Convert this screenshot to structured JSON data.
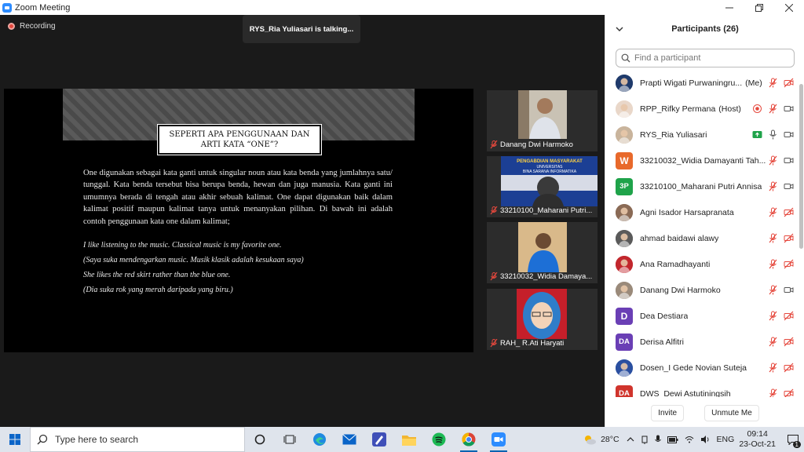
{
  "window": {
    "title": "Zoom Meeting"
  },
  "meeting": {
    "recording_label": "Recording",
    "talking_indicator": "RYS_Ria Yuliasari is talking..."
  },
  "slide": {
    "title_line1": "SEPERTI APA PENGGUNAAN DAN",
    "title_line2": "ARTI KATA “ONE”?",
    "body": "One digunakan sebagai kata ganti untuk singular noun atau kata benda yang jumlahnya satu/ tunggal. Kata benda tersebut bisa berupa benda, hewan dan juga manusia. Kata ganti ini umumnya berada di tengah atau akhir sebuah kalimat. One dapat digunakan baik dalam kalimat positif maupun kalimat tanya untuk menanyakan pilihan. Di bawah ini adalah contoh penggunaan kata one dalam kalimat;",
    "examples": [
      "I like listening to the music. Classical music is my favorite one.",
      "(Saya suka mendengarkan music. Musik klasik adalah kesukaan saya)",
      "She likes the red skirt rather than the blue one.",
      "(Dia suka rok yang merah daripada yang biru.)"
    ]
  },
  "video_tiles": [
    {
      "name": "Danang Dwi Harmoko"
    },
    {
      "name": "33210100_Maharani Putri..."
    },
    {
      "name": "33210032_Widia Damaya..."
    },
    {
      "name": "RAH_ R.Ati Haryati"
    }
  ],
  "tile2_banner": [
    "PENGABDIAN MASYARAKAT",
    "UNIVERSITAS",
    "BINA SARANA INFORMATIKA"
  ],
  "participants_panel": {
    "title": "Participants (26)",
    "search_placeholder": "Find a participant",
    "invite_label": "Invite",
    "unmute_label": "Unmute Me",
    "list": [
      {
        "name": "Prapti Wigati Purwaningru...",
        "tag": "(Me)",
        "avatar_type": "image",
        "color": "#1f3a6b",
        "mic": "muted",
        "video": "off"
      },
      {
        "name": "RPP_Rifky Permana",
        "tag": "(Host)",
        "avatar_type": "image",
        "color": "#e9d7c9",
        "mic": "muted",
        "video": "on",
        "recording": true
      },
      {
        "name": "RYS_Ria Yuliasari",
        "tag": "",
        "avatar_type": "image",
        "color": "#c9b49c",
        "mic": "on",
        "video": "on",
        "share": true
      },
      {
        "name": "33210032_Widia Damayanti Tah...",
        "tag": "",
        "avatar_type": "letter",
        "initials": "W",
        "color": "#e8692b",
        "mic": "muted",
        "video": "on"
      },
      {
        "name": "33210100_Maharani Putri Annisa",
        "tag": "",
        "avatar_type": "letter",
        "initials": "3P",
        "color": "#1fa34a",
        "mic": "muted",
        "video": "on"
      },
      {
        "name": "Agni Isador Harsapranata",
        "tag": "",
        "avatar_type": "image",
        "color": "#8a6a55",
        "mic": "muted",
        "video": "off"
      },
      {
        "name": "ahmad baidawi alawy",
        "tag": "",
        "avatar_type": "image",
        "color": "#5a5a5a",
        "mic": "muted",
        "video": "off"
      },
      {
        "name": "Ana Ramadhayanti",
        "tag": "",
        "avatar_type": "image",
        "color": "#c2272d",
        "mic": "muted",
        "video": "off"
      },
      {
        "name": "Danang Dwi Harmoko",
        "tag": "",
        "avatar_type": "image",
        "color": "#9a8a7a",
        "mic": "muted",
        "video": "on"
      },
      {
        "name": "Dea Destiara",
        "tag": "",
        "avatar_type": "letter",
        "initials": "D",
        "color": "#6a3fb5",
        "mic": "muted",
        "video": "off"
      },
      {
        "name": "Derisa Alfitri",
        "tag": "",
        "avatar_type": "letter",
        "initials": "DA",
        "color": "#6a3fb5",
        "mic": "muted",
        "video": "off"
      },
      {
        "name": "Dosen_I Gede Novian Suteja",
        "tag": "",
        "avatar_type": "image",
        "color": "#2a4fa0",
        "mic": "muted",
        "video": "off"
      },
      {
        "name": "DWS_Dewi Astutiningsih",
        "tag": "",
        "avatar_type": "letter",
        "initials": "DA",
        "color": "#d0342c",
        "mic": "muted",
        "video": "off"
      }
    ]
  },
  "taskbar": {
    "search_placeholder": "Type here to search",
    "weather": "28°C",
    "language": "ENG",
    "time": "09:14",
    "date": "23-Oct-21",
    "notification_count": "1"
  }
}
